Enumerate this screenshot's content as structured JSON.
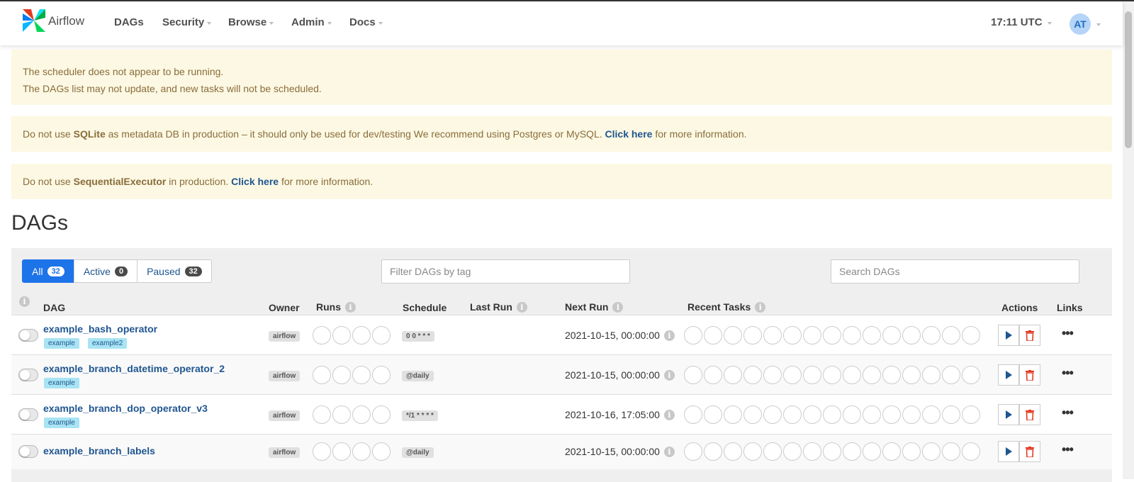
{
  "navbar": {
    "brand": "Airflow",
    "menu": [
      "DAGs",
      "Security",
      "Browse",
      "Admin",
      "Docs"
    ],
    "clock": "17:11 UTC",
    "avatar": "AT"
  },
  "alerts": {
    "scheduler_line1": "The scheduler does not appear to be running.",
    "scheduler_line2": "The DAGs list may not update, and new tasks will not be scheduled.",
    "sqlite_pre": "Do not use ",
    "sqlite_bold": "SQLite",
    "sqlite_mid": " as metadata DB in production – it should only be used for dev/testing We recommend using Postgres or MySQL. ",
    "sqlite_link": "Click here",
    "sqlite_post": " for more information.",
    "exec_pre": "Do not use ",
    "exec_bold": "SequentialExecutor",
    "exec_mid": " in production. ",
    "exec_link": "Click here",
    "exec_post": " for more information."
  },
  "page_title": "DAGs",
  "filters": {
    "all_label": "All",
    "all_count": "32",
    "active_label": "Active",
    "active_count": "0",
    "paused_label": "Paused",
    "paused_count": "32",
    "tag_placeholder": "Filter DAGs by tag",
    "search_placeholder": "Search DAGs"
  },
  "columns": {
    "dag": "DAG",
    "owner": "Owner",
    "runs": "Runs",
    "schedule": "Schedule",
    "last_run": "Last Run",
    "next_run": "Next Run",
    "recent_tasks": "Recent Tasks",
    "actions": "Actions",
    "links": "Links",
    "info_glyph": "i"
  },
  "dags": [
    {
      "id": "example_bash_operator",
      "tags": [
        "example",
        "example2"
      ],
      "owner": "airflow",
      "schedule": "0 0 * * *",
      "next_run": "2021-10-15, 00:00:00"
    },
    {
      "id": "example_branch_datetime_operator_2",
      "tags": [
        "example"
      ],
      "owner": "airflow",
      "schedule": "@daily",
      "next_run": "2021-10-15, 00:00:00"
    },
    {
      "id": "example_branch_dop_operator_v3",
      "tags": [
        "example"
      ],
      "owner": "airflow",
      "schedule": "*/1 * * * *",
      "next_run": "2021-10-16, 17:05:00"
    },
    {
      "id": "example_branch_labels",
      "tags": [],
      "owner": "airflow",
      "schedule": "@daily",
      "next_run": "2021-10-15, 00:00:00"
    }
  ],
  "icons": {
    "logo": "airflow-pinwheel-icon",
    "trigger": "play-icon",
    "delete": "trash-icon",
    "links": "ellipsis-icon",
    "info": "info-icon"
  },
  "colors": {
    "primary": "#1d73e8",
    "link": "#1f5590",
    "alert_bg": "#fcf8e3",
    "alert_text": "#8a6d3b",
    "tag_bg": "#a8e4f3",
    "danger": "#e43921"
  }
}
